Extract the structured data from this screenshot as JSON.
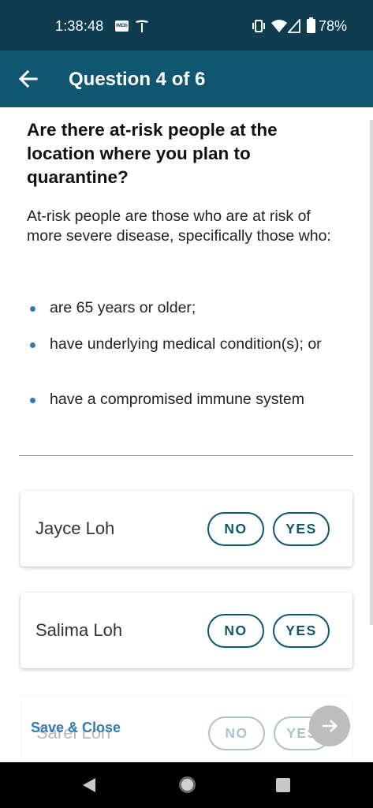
{
  "status_bar": {
    "time": "1:38:48",
    "imdb_text": "IMDb",
    "battery": "78%"
  },
  "header": {
    "title": "Question 4 of 6"
  },
  "question": {
    "title": "Are there at-risk people at the location where you plan to quarantine?",
    "explanation": "At-risk people are those who are at risk of more severe disease, specifically those who:",
    "bullets": [
      "are 65 years or older;",
      "have underlying medical condition(s); or",
      "have a compromised immune system"
    ]
  },
  "people": [
    {
      "name": "Jayce Loh",
      "no_label": "NO",
      "yes_label": "YES"
    },
    {
      "name": "Salima Loh",
      "no_label": "NO",
      "yes_label": "YES"
    },
    {
      "name": "Sarel Loh",
      "no_label": "NO",
      "yes_label": "YES"
    }
  ],
  "footer": {
    "save_close": "Save & Close"
  },
  "colors": {
    "status_bar": "#0f3d4f",
    "app_bar": "#0f5771",
    "accent": "#2f7cb0"
  }
}
